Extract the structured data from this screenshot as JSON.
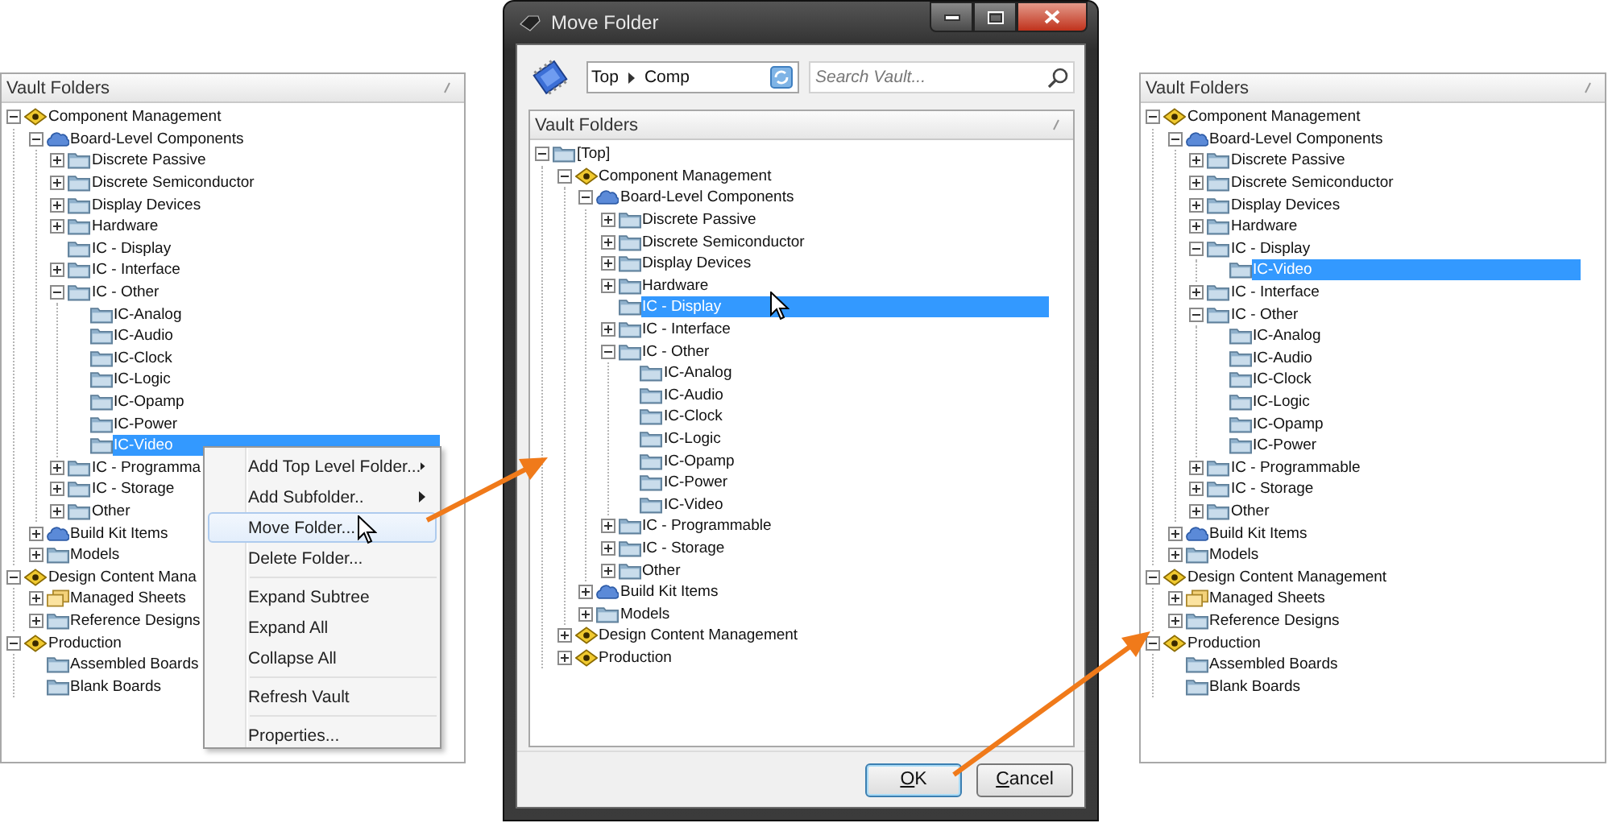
{
  "left_panel": {
    "header": "Vault Folders",
    "tree": [
      {
        "label": "Component Management",
        "kind": "category",
        "expanded": true,
        "selected": false,
        "children": [
          {
            "label": "Board-Level Components",
            "kind": "components",
            "expanded": true,
            "selected": false,
            "children": [
              {
                "label": "Discrete Passive",
                "kind": "folder",
                "expanded": false,
                "selected": false
              },
              {
                "label": "Discrete Semiconductor",
                "kind": "folder",
                "expanded": false,
                "selected": false
              },
              {
                "label": "Display Devices",
                "kind": "folder",
                "expanded": false,
                "selected": false
              },
              {
                "label": "Hardware",
                "kind": "folder",
                "expanded": false,
                "selected": false
              },
              {
                "label": "IC - Display",
                "kind": "folder",
                "selected": false
              },
              {
                "label": "IC - Interface",
                "kind": "folder",
                "expanded": false,
                "selected": false
              },
              {
                "label": "IC - Other",
                "kind": "folder",
                "expanded": true,
                "selected": false,
                "children": [
                  {
                    "label": "IC-Analog",
                    "kind": "folder",
                    "selected": false
                  },
                  {
                    "label": "IC-Audio",
                    "kind": "folder",
                    "selected": false
                  },
                  {
                    "label": "IC-Clock",
                    "kind": "folder",
                    "selected": false
                  },
                  {
                    "label": "IC-Logic",
                    "kind": "folder",
                    "selected": false
                  },
                  {
                    "label": "IC-Opamp",
                    "kind": "folder",
                    "selected": false
                  },
                  {
                    "label": "IC-Power",
                    "kind": "folder",
                    "selected": false
                  },
                  {
                    "label": "IC-Video",
                    "kind": "folder",
                    "selected": true
                  }
                ]
              },
              {
                "label": "IC - Programma",
                "kind": "folder",
                "expanded": false,
                "selected": false
              },
              {
                "label": "IC - Storage",
                "kind": "folder",
                "expanded": false,
                "selected": false
              },
              {
                "label": "Other",
                "kind": "folder",
                "expanded": false,
                "selected": false
              }
            ]
          },
          {
            "label": "Build Kit Items",
            "kind": "components",
            "expanded": false,
            "selected": false
          },
          {
            "label": "Models",
            "kind": "folder",
            "expanded": false,
            "selected": false
          }
        ]
      },
      {
        "label": "Design Content Mana",
        "kind": "category",
        "expanded": true,
        "selected": false,
        "children": [
          {
            "label": "Managed Sheets",
            "kind": "sheets",
            "expanded": false,
            "selected": false
          },
          {
            "label": "Reference Designs",
            "kind": "folder",
            "expanded": false,
            "selected": false
          }
        ]
      },
      {
        "label": "Production",
        "kind": "category",
        "expanded": true,
        "selected": false,
        "children": [
          {
            "label": "Assembled Boards",
            "kind": "folder",
            "selected": false
          },
          {
            "label": "Blank Boards",
            "kind": "folder",
            "selected": false
          }
        ]
      }
    ]
  },
  "context_menu": {
    "items": [
      {
        "kind": "item",
        "label": "Add Top Level Folder...",
        "submenu": true,
        "selected": false
      },
      {
        "kind": "item",
        "label": "Add Subfolder..",
        "submenu": true,
        "selected": false
      },
      {
        "kind": "item",
        "label": "Move Folder...",
        "submenu": false,
        "selected": true
      },
      {
        "kind": "item",
        "label": "Delete Folder...",
        "submenu": false,
        "selected": false
      },
      {
        "kind": "separator"
      },
      {
        "kind": "item",
        "label": "Expand Subtree",
        "submenu": false,
        "selected": false
      },
      {
        "kind": "item",
        "label": "Expand All",
        "submenu": false,
        "selected": false
      },
      {
        "kind": "item",
        "label": "Collapse All",
        "submenu": false,
        "selected": false
      },
      {
        "kind": "separator"
      },
      {
        "kind": "item",
        "label": "Refresh Vault",
        "submenu": false,
        "selected": false
      },
      {
        "kind": "separator"
      },
      {
        "kind": "item",
        "label": "Properties...",
        "submenu": false,
        "selected": false
      }
    ]
  },
  "dialog": {
    "title": "Move Folder",
    "path": [
      "Top",
      "Comp"
    ],
    "search": {
      "placeholder": "Search Vault..."
    },
    "header": "Vault Folders",
    "tree": [
      {
        "label": "[Top]",
        "kind": "folder",
        "expanded": true,
        "selected": false,
        "children": [
          {
            "label": "Component Management",
            "kind": "category",
            "expanded": true,
            "selected": false,
            "children": [
              {
                "label": "Board-Level Components",
                "kind": "components",
                "expanded": true,
                "selected": false,
                "children": [
                  {
                    "label": "Discrete Passive",
                    "kind": "folder",
                    "expanded": false,
                    "selected": false
                  },
                  {
                    "label": "Discrete Semiconductor",
                    "kind": "folder",
                    "expanded": false,
                    "selected": false
                  },
                  {
                    "label": "Display Devices",
                    "kind": "folder",
                    "expanded": false,
                    "selected": false
                  },
                  {
                    "label": "Hardware",
                    "kind": "folder",
                    "expanded": false,
                    "selected": false
                  },
                  {
                    "label": "IC - Display",
                    "kind": "folder",
                    "selected": true
                  },
                  {
                    "label": "IC - Interface",
                    "kind": "folder",
                    "expanded": false,
                    "selected": false
                  },
                  {
                    "label": "IC - Other",
                    "kind": "folder",
                    "expanded": true,
                    "selected": false,
                    "children": [
                      {
                        "label": "IC-Analog",
                        "kind": "folder",
                        "selected": false
                      },
                      {
                        "label": "IC-Audio",
                        "kind": "folder",
                        "selected": false
                      },
                      {
                        "label": "IC-Clock",
                        "kind": "folder",
                        "selected": false
                      },
                      {
                        "label": "IC-Logic",
                        "kind": "folder",
                        "selected": false
                      },
                      {
                        "label": "IC-Opamp",
                        "kind": "folder",
                        "selected": false
                      },
                      {
                        "label": "IC-Power",
                        "kind": "folder",
                        "selected": false
                      },
                      {
                        "label": "IC-Video",
                        "kind": "folder",
                        "selected": false
                      }
                    ]
                  },
                  {
                    "label": "IC - Programmable",
                    "kind": "folder",
                    "expanded": false,
                    "selected": false
                  },
                  {
                    "label": "IC - Storage",
                    "kind": "folder",
                    "expanded": false,
                    "selected": false
                  },
                  {
                    "label": "Other",
                    "kind": "folder",
                    "expanded": false,
                    "selected": false
                  }
                ]
              },
              {
                "label": "Build Kit Items",
                "kind": "components",
                "expanded": false,
                "selected": false
              },
              {
                "label": "Models",
                "kind": "folder",
                "expanded": false,
                "selected": false
              }
            ]
          },
          {
            "label": "Design Content Management",
            "kind": "category",
            "expanded": false,
            "selected": false
          },
          {
            "label": "Production",
            "kind": "category",
            "expanded": false,
            "selected": false
          }
        ]
      }
    ],
    "buttons": [
      {
        "label": "OK",
        "default": true
      },
      {
        "label": "Cancel",
        "default": false
      }
    ]
  },
  "right_panel": {
    "header": "Vault Folders",
    "tree": [
      {
        "label": "Component Management",
        "kind": "category",
        "expanded": true,
        "selected": false,
        "children": [
          {
            "label": "Board-Level Components",
            "kind": "components",
            "expanded": true,
            "selected": false,
            "children": [
              {
                "label": "Discrete Passive",
                "kind": "folder",
                "expanded": false,
                "selected": false
              },
              {
                "label": "Discrete Semiconductor",
                "kind": "folder",
                "expanded": false,
                "selected": false
              },
              {
                "label": "Display Devices",
                "kind": "folder",
                "expanded": false,
                "selected": false
              },
              {
                "label": "Hardware",
                "kind": "folder",
                "expanded": false,
                "selected": false
              },
              {
                "label": "IC - Display",
                "kind": "folder",
                "expanded": true,
                "selected": false,
                "children": [
                  {
                    "label": "IC-Video",
                    "kind": "folder",
                    "selected": true
                  }
                ]
              },
              {
                "label": "IC - Interface",
                "kind": "folder",
                "expanded": false,
                "selected": false
              },
              {
                "label": "IC - Other",
                "kind": "folder",
                "expanded": true,
                "selected": false,
                "children": [
                  {
                    "label": "IC-Analog",
                    "kind": "folder",
                    "selected": false
                  },
                  {
                    "label": "IC-Audio",
                    "kind": "folder",
                    "selected": false
                  },
                  {
                    "label": "IC-Clock",
                    "kind": "folder",
                    "selected": false
                  },
                  {
                    "label": "IC-Logic",
                    "kind": "folder",
                    "selected": false
                  },
                  {
                    "label": "IC-Opamp",
                    "kind": "folder",
                    "selected": false
                  },
                  {
                    "label": "IC-Power",
                    "kind": "folder",
                    "selected": false
                  }
                ]
              },
              {
                "label": "IC - Programmable",
                "kind": "folder",
                "expanded": false,
                "selected": false
              },
              {
                "label": "IC - Storage",
                "kind": "folder",
                "expanded": false,
                "selected": false
              },
              {
                "label": "Other",
                "kind": "folder",
                "expanded": false,
                "selected": false
              }
            ]
          },
          {
            "label": "Build Kit Items",
            "kind": "components",
            "expanded": false,
            "selected": false
          },
          {
            "label": "Models",
            "kind": "folder",
            "expanded": false,
            "selected": false
          }
        ]
      },
      {
        "label": "Design Content Management",
        "kind": "category",
        "expanded": true,
        "selected": false,
        "children": [
          {
            "label": "Managed Sheets",
            "kind": "sheets",
            "expanded": false,
            "selected": false
          },
          {
            "label": "Reference Designs",
            "kind": "folder",
            "expanded": false,
            "selected": false
          }
        ]
      },
      {
        "label": "Production",
        "kind": "category",
        "expanded": true,
        "selected": false,
        "children": [
          {
            "label": "Assembled Boards",
            "kind": "folder",
            "selected": false
          },
          {
            "label": "Blank Boards",
            "kind": "folder",
            "selected": false
          }
        ]
      }
    ]
  }
}
